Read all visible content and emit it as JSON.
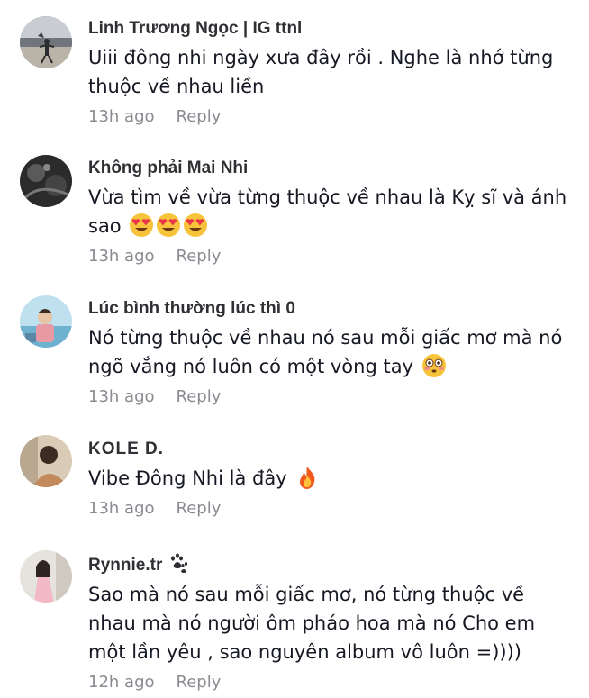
{
  "comments": [
    {
      "username": "Linh Trương Ngọc | IG ttnl",
      "text": "Uiii đông nhi ngày xưa đây rồi . Nghe là nhớ từng thuộc về nhau liền",
      "time": "13h ago",
      "reply": "Reply",
      "avatar_icon": "beach-silhouette-avatar"
    },
    {
      "username": "Không phải Mai Nhi",
      "text": "Vừa tìm về vừa từng thuộc về nhau là Kỵ sĩ và ánh sao",
      "emojis": [
        "heart-eyes-emoji",
        "heart-eyes-emoji",
        "heart-eyes-emoji"
      ],
      "time": "13h ago",
      "reply": "Reply",
      "avatar_icon": "dark-abstract-avatar"
    },
    {
      "username": "Lúc bình thường lúc thì 0",
      "text": "Nó từng thuộc về nhau nó sau mỗi giấc mơ mà nó ngõ vắng nó luôn có một vòng tay",
      "emojis": [
        "flushed-face-emoji"
      ],
      "time": "13h ago",
      "reply": "Reply",
      "avatar_icon": "person-by-water-avatar"
    },
    {
      "username": "KOLE D.",
      "text": "Vibe Đông Nhi là đây",
      "emojis": [
        "fire-emoji"
      ],
      "time": "13h ago",
      "reply": "Reply",
      "avatar_icon": "person-in-room-avatar"
    },
    {
      "username": "Rynnie.tr",
      "username_emoji": "paw-prints-emoji",
      "text": "Sao mà nó sau mỗi giấc mơ, nó từng thuộc về nhau mà nó người ôm pháo hoa mà nó Cho em một lần yêu , sao nguyên album vô luôn =))))",
      "time": "12h ago",
      "reply": "Reply",
      "avatar_icon": "woman-portrait-avatar"
    }
  ],
  "colors": {
    "username": "#2f3034",
    "text": "#161823",
    "meta": "#8a8b91",
    "background": "#ffffff"
  }
}
